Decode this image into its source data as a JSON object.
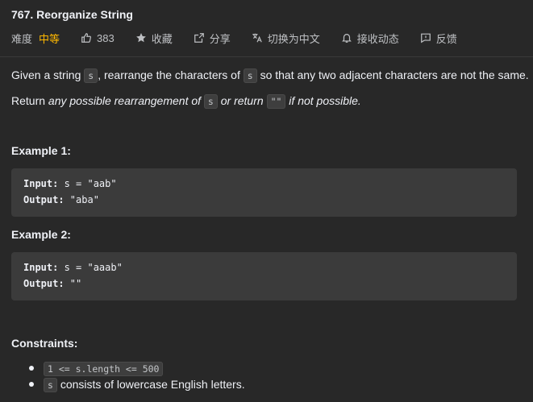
{
  "problem": {
    "title": "767. Reorganize String",
    "difficulty_label": "难度",
    "difficulty": "中等",
    "likes": "383",
    "favorite_label": "收藏",
    "share_label": "分享",
    "translate_label": "切换为中文",
    "subscribe_label": "接收动态",
    "feedback_label": "反馈"
  },
  "description": {
    "p1_a": "Given a string ",
    "p1_code1": "s",
    "p1_b": ", rearrange the characters of ",
    "p1_code2": "s",
    "p1_c": " so that any two adjacent characters are not the same.",
    "p2_a": "Return ",
    "p2_em1": "any possible rearrangement of ",
    "p2_code1": "s",
    "p2_em2": " or return ",
    "p2_code2": "\"\"",
    "p2_em3": " if not possible."
  },
  "examples": [
    {
      "heading": "Example 1:",
      "input_label": "Input:",
      "input_value": " s = \"aab\"",
      "output_label": "Output:",
      "output_value": " \"aba\""
    },
    {
      "heading": "Example 2:",
      "input_label": "Input:",
      "input_value": " s = \"aaab\"",
      "output_label": "Output:",
      "output_value": " \"\""
    }
  ],
  "constraints": {
    "heading": "Constraints:",
    "c1_code": "1 <= s.length <= 500",
    "c2_code": "s",
    "c2_text": " consists of lowercase English letters."
  },
  "colors": {
    "background": "#282828",
    "medium_difficulty": "#ffb800",
    "code_block": "#3b3b3b"
  }
}
